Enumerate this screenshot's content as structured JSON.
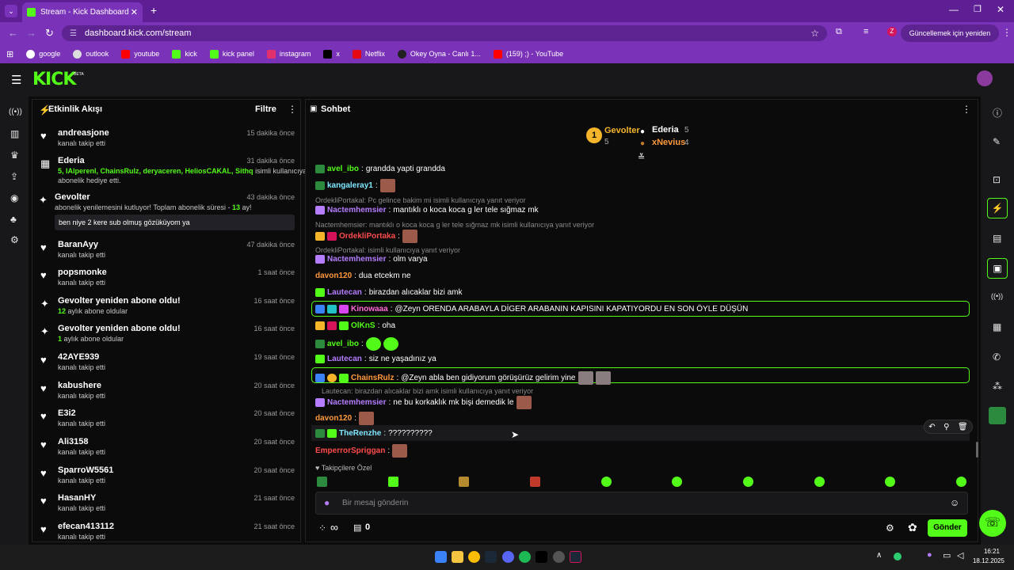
{
  "browser": {
    "tab_title": "Stream - Kick Dashboard",
    "url": "dashboard.kick.com/stream",
    "update_button": "Güncellemek için yeniden başlat",
    "profile_initial": "Z",
    "bookmarks": [
      {
        "label": "google"
      },
      {
        "label": "outlook"
      },
      {
        "label": "youtube"
      },
      {
        "label": "kick"
      },
      {
        "label": "kick panel"
      },
      {
        "label": "instagram"
      },
      {
        "label": "x"
      },
      {
        "label": "Netflix"
      },
      {
        "label": "Okey Oyna - Canlı 1..."
      },
      {
        "label": "(159) ;) - YouTube"
      }
    ]
  },
  "kick": {
    "logo": "KICK",
    "logo_beta": "BETA",
    "brand_color": "#53fc18"
  },
  "activity": {
    "title": "Etkinlik Akışı",
    "filter_label": "Filtre",
    "events": [
      {
        "user": "andreasjone",
        "time": "15 dakika önce",
        "sub": "kanalı takip etti",
        "icon": "heart"
      },
      {
        "user": "Ederia",
        "time": "31 dakika önce",
        "gift_names": "5, IAlperenl, ChainsRulz, deryaceren, HeliosCAKAL, Sithq",
        "gift_suffix": " isimli kullanıcıya",
        "sub2": "abonelik hediye etti.",
        "icon": "gift"
      },
      {
        "user": "Gevolter",
        "time": "43 dakika önce",
        "resub_prefix": "abonelik yenilemesini kutluyor! Toplam abonelik süresi - ",
        "resub_months": "13",
        "resub_suffix": " ay!",
        "message": "ben niye 2 kere sub olmuş gözüküyom ya",
        "icon": "star"
      },
      {
        "user": "BaranAyy",
        "time": "47 dakika önce",
        "sub": "kanalı takip etti",
        "icon": "heart"
      },
      {
        "user": "popsmonke",
        "time": "1 saat önce",
        "sub": "kanalı takip etti",
        "icon": "heart"
      },
      {
        "user": "Gevolter yeniden abone oldu!",
        "time": "16 saat önce",
        "count": "12",
        "count_suffix": " aylık abone oldular",
        "icon": "star"
      },
      {
        "user": "Gevolter yeniden abone oldu!",
        "time": "16 saat önce",
        "count": "1",
        "count_suffix": " aylık abone oldular",
        "icon": "star"
      },
      {
        "user": "42AYE939",
        "time": "19 saat önce",
        "sub": "kanalı takip etti",
        "icon": "heart"
      },
      {
        "user": "kabushere",
        "time": "20 saat önce",
        "sub": "kanalı takip etti",
        "icon": "heart"
      },
      {
        "user": "E3i2",
        "time": "20 saat önce",
        "sub": "kanalı takip etti",
        "icon": "heart"
      },
      {
        "user": "Ali3158",
        "time": "20 saat önce",
        "sub": "kanalı takip etti",
        "icon": "heart"
      },
      {
        "user": "SparroW5561",
        "time": "20 saat önce",
        "sub": "kanalı takip etti",
        "icon": "heart"
      },
      {
        "user": "HasanHY",
        "time": "21 saat önce",
        "sub": "kanalı takip etti",
        "icon": "heart"
      },
      {
        "user": "efecan413112",
        "time": "21 saat önce",
        "sub": "kanalı takip etti",
        "icon": "heart"
      }
    ]
  },
  "chat": {
    "title": "Sohbet",
    "leaderboard": {
      "first": {
        "rank": "1",
        "name": "Gevolter",
        "count": "5"
      },
      "second": {
        "name": "Ederia",
        "count": "5"
      },
      "third": {
        "name": "xNevius",
        "count": "4"
      }
    },
    "messages": [
      {
        "user": "avel_ibo",
        "color": "#53fc18",
        "text": "grandda yapti grandda"
      },
      {
        "user": "kangaleray1",
        "color": "#7ee8ff",
        "text": ""
      },
      {
        "reply": "OrdekliPortakal: Pc gelince bakim mi isimli kullanıcıya yanıt veriyor"
      },
      {
        "user": "Nactemhemsier",
        "color": "#b57dff",
        "text": "mantıklı o koca koca g ler tele sığmaz mk"
      },
      {
        "reply": "Nactemhemsier: mantıklı o koca koca g ler tele sığmaz mk  isimli kullanıcıya yanıt veriyor"
      },
      {
        "user": "OrdekliPortaka",
        "color": "#ff4b4b",
        "text": ""
      },
      {
        "reply": "OrdekliPortakal:      isimli kullanıcıya yanıt veriyor"
      },
      {
        "user": "Nactemhemsier",
        "color": "#b57dff",
        "text": "olm varya"
      },
      {
        "user": "davon120",
        "color": "#ff9a3c",
        "text": "dua etcekm ne"
      },
      {
        "user": "Lautecan",
        "color": "#b57dff",
        "text": "birazdan alıcaklar bizi amk"
      },
      {
        "user": "Kinowaaa",
        "color": "#ff6ad5",
        "text": "@Zeyn ORENDA ARABAYLA DİGER ARABANIN KAPISINI KAPATIYORDU EN SON ÖYLE DÜŞÜN"
      },
      {
        "user": "OlKnS",
        "color": "#53fc18",
        "text": "oha"
      },
      {
        "user": "avel_ibo",
        "color": "#53fc18",
        "text": ""
      },
      {
        "user": "Lautecan",
        "color": "#b57dff",
        "text": "siz ne yaşadınız ya"
      },
      {
        "user": "ChainsRulz",
        "color": "#ff9a3c",
        "text": "@Zeyn abla ben gidiyorum görüşürüz gelirim yine"
      },
      {
        "reply": "Lautecan: birazdan alıcaklar bizi amk isimli kullanıcıya yanıt veriyor"
      },
      {
        "user": "Nactemhemsier",
        "color": "#b57dff",
        "text": "ne bu korkaklık mk bişi demedik le"
      },
      {
        "user": "davon120",
        "color": "#ff9a3c",
        "text": ""
      },
      {
        "user": "TheRenzhe",
        "color": "#7ee8ff",
        "text": "??????????"
      },
      {
        "user": "EmperrorSpriggan",
        "color": "#ff4b4b",
        "text": ""
      }
    ],
    "followers_only": "Takipçilere Özel",
    "input_placeholder": "Bir mesaj gönderin",
    "send_label": "Gönder",
    "infinity": "∞",
    "points": "0"
  },
  "taskbar": {
    "time": "16:21",
    "date": "18.12.2025"
  }
}
